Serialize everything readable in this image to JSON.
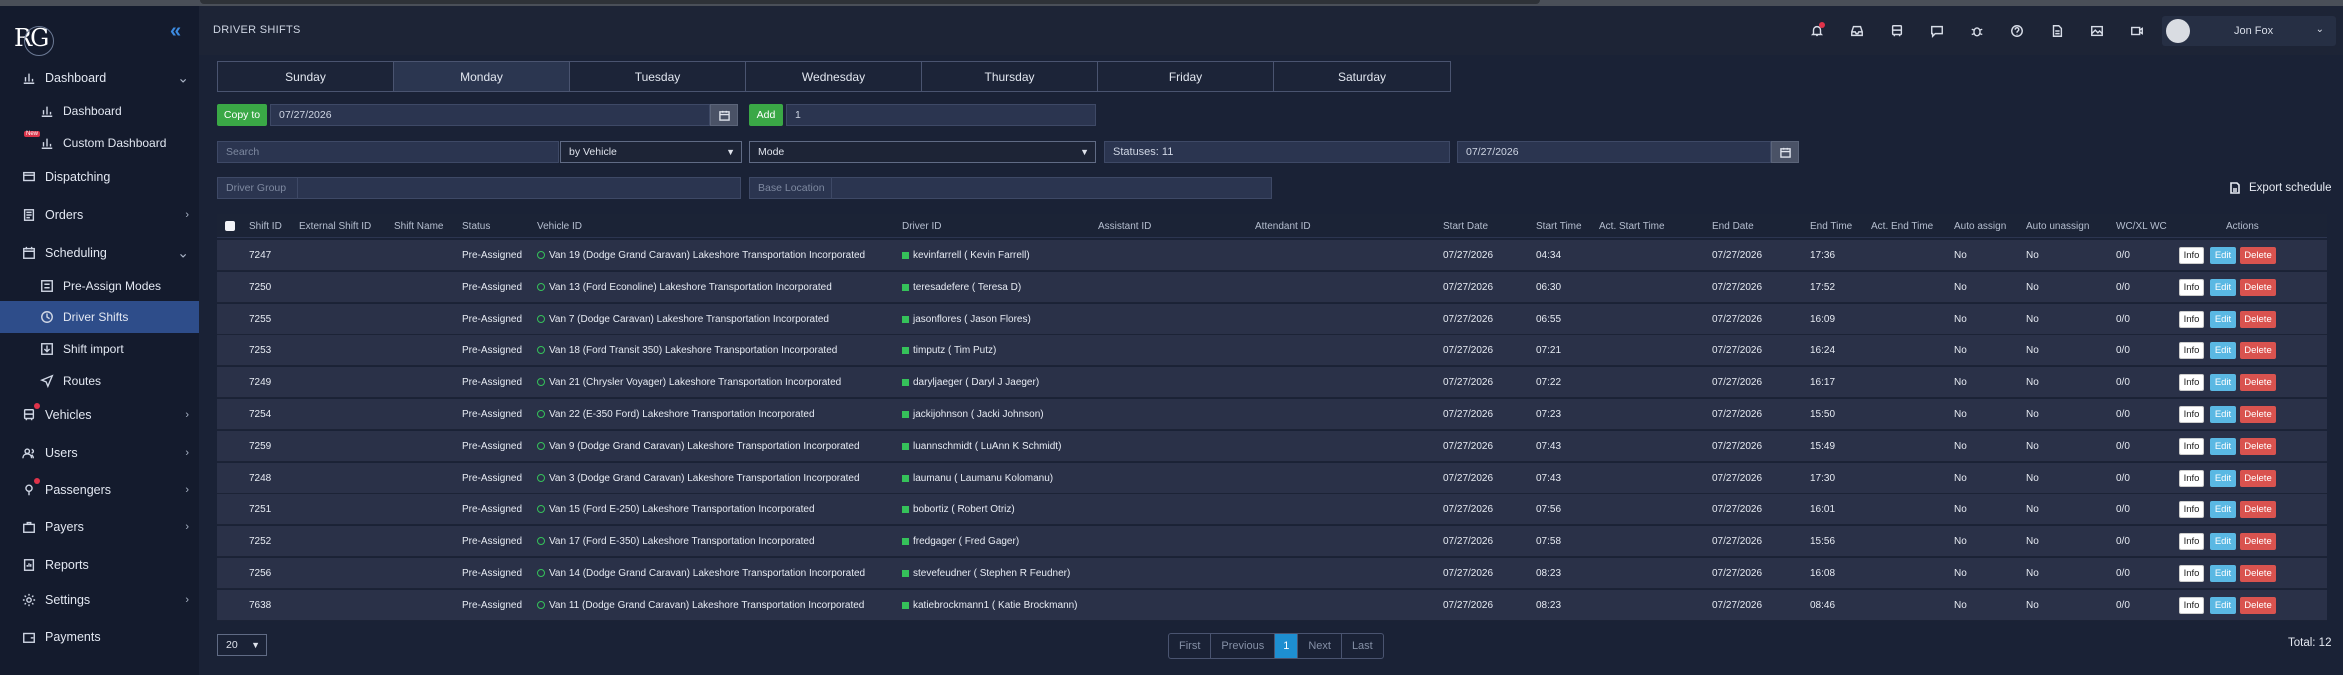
{
  "app": {
    "logo": "RG",
    "page_title": "DRIVER SHIFTS"
  },
  "sidebar": {
    "items": [
      {
        "label": "Dashboard",
        "icon": "chart-icon",
        "expanded": true
      },
      {
        "label": "Dashboard",
        "icon": "chart-icon",
        "sub": true
      },
      {
        "label": "Custom Dashboard",
        "icon": "chart-icon",
        "sub": true,
        "badge": "New"
      },
      {
        "label": "Dispatching",
        "icon": "dispatch-icon"
      },
      {
        "label": "Orders",
        "icon": "orders-icon"
      },
      {
        "label": "Scheduling",
        "icon": "calendar-icon",
        "expanded": true
      },
      {
        "label": "Pre-Assign Modes",
        "icon": "modes-icon",
        "sub": true
      },
      {
        "label": "Driver Shifts",
        "icon": "clock-icon",
        "sub": true,
        "active": true
      },
      {
        "label": "Shift import",
        "icon": "import-icon",
        "sub": true
      },
      {
        "label": "Routes",
        "icon": "navigation-icon",
        "sub": true
      },
      {
        "label": "Vehicles",
        "icon": "bus-icon"
      },
      {
        "label": "Users",
        "icon": "users-icon"
      },
      {
        "label": "Passengers",
        "icon": "passenger-icon"
      },
      {
        "label": "Payers",
        "icon": "briefcase-icon"
      },
      {
        "label": "Reports",
        "icon": "report-icon"
      },
      {
        "label": "Settings",
        "icon": "gear-icon"
      },
      {
        "label": "Payments",
        "icon": "wallet-icon"
      }
    ]
  },
  "header": {
    "user_name": "Jon Fox",
    "icons": [
      "bell-icon",
      "inbox-icon",
      "bus-icon",
      "chat-icon",
      "bug-icon",
      "help-icon",
      "document-icon",
      "image-icon",
      "video-icon"
    ]
  },
  "days": [
    "Sunday",
    "Monday",
    "Tuesday",
    "Wednesday",
    "Thursday",
    "Friday",
    "Saturday"
  ],
  "active_day": "Monday",
  "controls": {
    "copy_to_label": "Copy to",
    "copy_to_date": "07/27/2026",
    "add_label": "Add",
    "add_value": "1",
    "search_placeholder": "Search",
    "by_vehicle": "by Vehicle",
    "mode": "Mode",
    "statuses": "Statuses: 11",
    "date": "07/27/2026",
    "driver_group_placeholder": "Driver Group",
    "base_location_placeholder": "Base Location",
    "export_label": "Export schedule"
  },
  "table": {
    "columns": [
      "Shift ID",
      "External Shift ID",
      "Shift Name",
      "Status",
      "Vehicle ID",
      "Driver ID",
      "Assistant ID",
      "Attendant ID",
      "Start Date",
      "Start Time",
      "Act. Start Time",
      "End Date",
      "End Time",
      "Act. End Time",
      "Auto assign",
      "Auto unassign",
      "WC/XL WC",
      "Actions"
    ],
    "action_labels": {
      "info": "Info",
      "edit": "Edit",
      "delete": "Delete"
    },
    "rows": [
      {
        "id": "7247",
        "status": "Pre-Assigned",
        "vehicle": "Van 19  (Dodge Grand Caravan)  Lakeshore Transportation Incorporated",
        "driver": "kevinfarrell ( Kevin Farrell)",
        "start_date": "07/27/2026",
        "start_time": "04:34",
        "end_date": "07/27/2026",
        "end_time": "17:36",
        "auto_assign": "No",
        "auto_unassign": "No",
        "wc": "0/0"
      },
      {
        "id": "7250",
        "status": "Pre-Assigned",
        "vehicle": "Van 13  (Ford Econoline)  Lakeshore Transportation Incorporated",
        "driver": "teresadefere ( Teresa D)",
        "start_date": "07/27/2026",
        "start_time": "06:30",
        "end_date": "07/27/2026",
        "end_time": "17:52",
        "auto_assign": "No",
        "auto_unassign": "No",
        "wc": "0/0"
      },
      {
        "id": "7255",
        "status": "Pre-Assigned",
        "vehicle": "Van 7  (Dodge Caravan)  Lakeshore Transportation Incorporated",
        "driver": "jasonflores ( Jason Flores)",
        "start_date": "07/27/2026",
        "start_time": "06:55",
        "end_date": "07/27/2026",
        "end_time": "16:09",
        "auto_assign": "No",
        "auto_unassign": "No",
        "wc": "0/0"
      },
      {
        "id": "7253",
        "status": "Pre-Assigned",
        "vehicle": "Van 18  (Ford Transit 350)  Lakeshore Transportation Incorporated",
        "driver": "timputz ( Tim Putz)",
        "start_date": "07/27/2026",
        "start_time": "07:21",
        "end_date": "07/27/2026",
        "end_time": "16:24",
        "auto_assign": "No",
        "auto_unassign": "No",
        "wc": "0/0"
      },
      {
        "id": "7249",
        "status": "Pre-Assigned",
        "vehicle": "Van 21  (Chrysler Voyager)  Lakeshore Transportation Incorporated",
        "driver": "daryljaeger ( Daryl J Jaeger)",
        "start_date": "07/27/2026",
        "start_time": "07:22",
        "end_date": "07/27/2026",
        "end_time": "16:17",
        "auto_assign": "No",
        "auto_unassign": "No",
        "wc": "0/0"
      },
      {
        "id": "7254",
        "status": "Pre-Assigned",
        "vehicle": "Van 22  (E-350 Ford)  Lakeshore Transportation Incorporated",
        "driver": "jackijohnson ( Jacki Johnson)",
        "start_date": "07/27/2026",
        "start_time": "07:23",
        "end_date": "07/27/2026",
        "end_time": "15:50",
        "auto_assign": "No",
        "auto_unassign": "No",
        "wc": "0/0"
      },
      {
        "id": "7259",
        "status": "Pre-Assigned",
        "vehicle": "Van 9  (Dodge Grand Caravan)  Lakeshore Transportation Incorporated",
        "driver": "luannschmidt ( LuAnn K Schmidt)",
        "start_date": "07/27/2026",
        "start_time": "07:43",
        "end_date": "07/27/2026",
        "end_time": "15:49",
        "auto_assign": "No",
        "auto_unassign": "No",
        "wc": "0/0"
      },
      {
        "id": "7248",
        "status": "Pre-Assigned",
        "vehicle": "Van 3  (Dodge Grand Caravan)  Lakeshore Transportation Incorporated",
        "driver": "laumanu ( Laumanu Kolomanu)",
        "start_date": "07/27/2026",
        "start_time": "07:43",
        "end_date": "07/27/2026",
        "end_time": "17:30",
        "auto_assign": "No",
        "auto_unassign": "No",
        "wc": "0/0"
      },
      {
        "id": "7251",
        "status": "Pre-Assigned",
        "vehicle": "Van 15  (Ford E-250)  Lakeshore Transportation Incorporated",
        "driver": "bobortiz ( Robert Otriz)",
        "start_date": "07/27/2026",
        "start_time": "07:56",
        "end_date": "07/27/2026",
        "end_time": "16:01",
        "auto_assign": "No",
        "auto_unassign": "No",
        "wc": "0/0"
      },
      {
        "id": "7252",
        "status": "Pre-Assigned",
        "vehicle": "Van 17  (Ford E-350)  Lakeshore Transportation Incorporated",
        "driver": "fredgager ( Fred Gager)",
        "start_date": "07/27/2026",
        "start_time": "07:58",
        "end_date": "07/27/2026",
        "end_time": "15:56",
        "auto_assign": "No",
        "auto_unassign": "No",
        "wc": "0/0"
      },
      {
        "id": "7256",
        "status": "Pre-Assigned",
        "vehicle": "Van 14  (Dodge Grand Caravan)  Lakeshore Transportation Incorporated",
        "driver": "stevefeudner ( Stephen R Feudner)",
        "start_date": "07/27/2026",
        "start_time": "08:23",
        "end_date": "07/27/2026",
        "end_time": "16:08",
        "auto_assign": "No",
        "auto_unassign": "No",
        "wc": "0/0"
      },
      {
        "id": "7638",
        "status": "Pre-Assigned",
        "vehicle": "Van 11  (Dodge Grand Caravan)  Lakeshore Transportation Incorporated",
        "driver": "katiebrockmann1 ( Katie Brockmann)",
        "start_date": "07/27/2026",
        "start_time": "08:23",
        "end_date": "07/27/2026",
        "end_time": "08:46",
        "auto_assign": "No",
        "auto_unassign": "No",
        "wc": "0/0"
      }
    ]
  },
  "footer": {
    "per_page": "20",
    "pager": [
      "First",
      "Previous",
      "1",
      "Next",
      "Last"
    ],
    "current_page": "1",
    "total": "Total: 12"
  },
  "colors": {
    "accent": "#2e4d8a",
    "green": "#3aa846",
    "danger": "#d9534f",
    "info": "#5ab8e3",
    "page_active": "#1e8fd1"
  }
}
